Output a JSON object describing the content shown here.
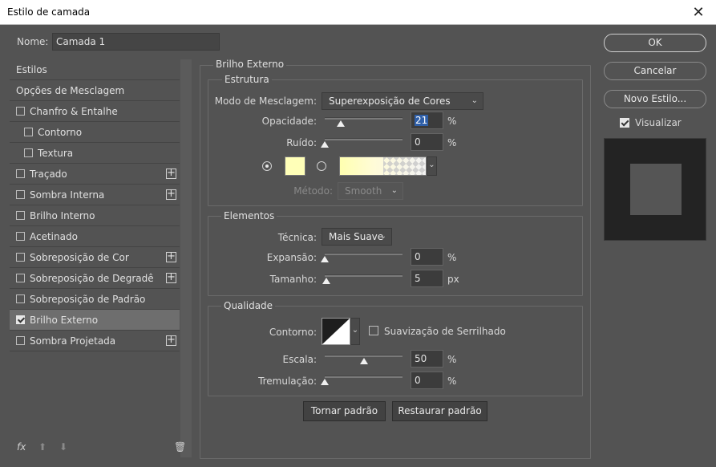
{
  "window": {
    "title": "Estilo de camada",
    "close_glyph": "✕"
  },
  "name_field": {
    "label": "Nome:",
    "value": "Camada 1"
  },
  "styles_list": {
    "items": [
      {
        "label": "Estilos",
        "checkbox": false,
        "checked": false,
        "plus": false,
        "indent": 0,
        "selected": false
      },
      {
        "label": "Opções de Mesclagem",
        "checkbox": false,
        "checked": false,
        "plus": false,
        "indent": 0,
        "selected": false
      },
      {
        "label": "Chanfro & Entalhe",
        "checkbox": true,
        "checked": false,
        "plus": false,
        "indent": 0,
        "selected": false
      },
      {
        "label": "Contorno",
        "checkbox": true,
        "checked": false,
        "plus": false,
        "indent": 1,
        "selected": false
      },
      {
        "label": "Textura",
        "checkbox": true,
        "checked": false,
        "plus": false,
        "indent": 1,
        "selected": false
      },
      {
        "label": "Traçado",
        "checkbox": true,
        "checked": false,
        "plus": true,
        "indent": 0,
        "selected": false
      },
      {
        "label": "Sombra Interna",
        "checkbox": true,
        "checked": false,
        "plus": true,
        "indent": 0,
        "selected": false
      },
      {
        "label": "Brilho Interno",
        "checkbox": true,
        "checked": false,
        "plus": false,
        "indent": 0,
        "selected": false
      },
      {
        "label": "Acetinado",
        "checkbox": true,
        "checked": false,
        "plus": false,
        "indent": 0,
        "selected": false
      },
      {
        "label": "Sobreposição de Cor",
        "checkbox": true,
        "checked": false,
        "plus": true,
        "indent": 0,
        "selected": false
      },
      {
        "label": "Sobreposição de Degradê",
        "checkbox": true,
        "checked": false,
        "plus": true,
        "indent": 0,
        "selected": false
      },
      {
        "label": "Sobreposição de Padrão",
        "checkbox": true,
        "checked": false,
        "plus": false,
        "indent": 0,
        "selected": false
      },
      {
        "label": "Brilho Externo",
        "checkbox": true,
        "checked": true,
        "plus": false,
        "indent": 0,
        "selected": true
      },
      {
        "label": "Sombra Projetada",
        "checkbox": true,
        "checked": false,
        "plus": true,
        "indent": 0,
        "selected": false
      }
    ],
    "bottom": {
      "fx": "fx",
      "up": "⬆",
      "down": "⬇",
      "trash": "🗑"
    }
  },
  "panel": {
    "title": "Brilho Externo",
    "estrutura": {
      "title": "Estrutura",
      "blend_mode_label": "Modo de Mesclagem:",
      "blend_mode_value": "Superexposição de Cores",
      "opacity_label": "Opacidade:",
      "opacity_value": "21",
      "opacity_pct": 21,
      "noise_label": "Ruído:",
      "noise_value": "0",
      "noise_pct": 0,
      "unit_pct": "%",
      "swatch_color": "#ffffb8",
      "method_label": "Método:",
      "method_value": "Smooth"
    },
    "elementos": {
      "title": "Elementos",
      "technique_label": "Técnica:",
      "technique_value": "Mais Suave",
      "spread_label": "Expansão:",
      "spread_value": "0",
      "spread_pct": 0,
      "size_label": "Tamanho:",
      "size_value": "5",
      "size_fraction": 0.02,
      "unit_pct": "%",
      "unit_px": "px"
    },
    "qualidade": {
      "title": "Qualidade",
      "contour_label": "Contorno:",
      "antialias_label": "Suavização de Serrilhado",
      "range_label": "Escala:",
      "range_value": "50",
      "range_pct": 50,
      "jitter_label": "Tremulação:",
      "jitter_value": "0",
      "jitter_pct": 0,
      "unit_pct": "%"
    },
    "make_default": "Tornar padrão",
    "reset_default": "Restaurar padrão"
  },
  "right": {
    "ok": "OK",
    "cancel": "Cancelar",
    "new_style": "Novo Estilo...",
    "preview_label": "Visualizar",
    "preview_checked": true
  }
}
